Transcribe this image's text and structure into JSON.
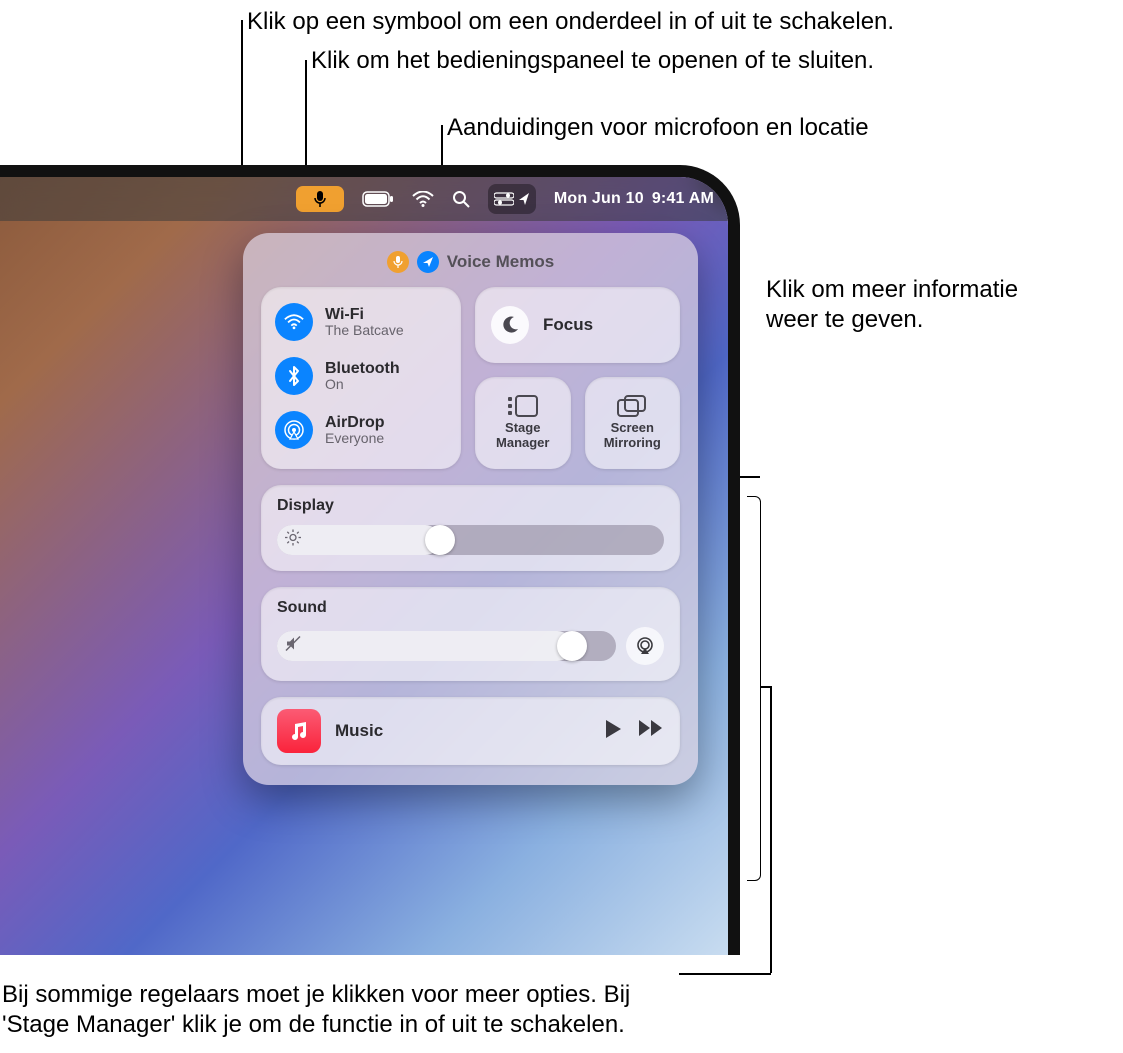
{
  "callouts": {
    "toggle": "Klik op een symbool om een onderdeel in of uit te schakelen.",
    "open_cc": "Klik om het bedieningspaneel te openen of te sluiten.",
    "indicators": "Aanduidingen voor microfoon en locatie",
    "more_info_1": "Klik om meer informatie",
    "more_info_2": "weer te geven.",
    "bottom_1": "Bij sommige regelaars moet je klikken voor meer opties. Bij",
    "bottom_2": "'Stage Manager' klik je om de functie in of uit te schakelen."
  },
  "menubar": {
    "date": "Mon Jun 10",
    "time": "9:41 AM"
  },
  "status_app": "Voice Memos",
  "connectivity": {
    "wifi": {
      "title": "Wi-Fi",
      "subtitle": "The Batcave"
    },
    "bluetooth": {
      "title": "Bluetooth",
      "subtitle": "On"
    },
    "airdrop": {
      "title": "AirDrop",
      "subtitle": "Everyone"
    }
  },
  "focus_label": "Focus",
  "stage": {
    "l1": "Stage",
    "l2": "Manager"
  },
  "mirror": {
    "l1": "Screen",
    "l2": "Mirroring"
  },
  "display_label": "Display",
  "sound_label": "Sound",
  "media_label": "Music",
  "sliders": {
    "display_pct": 42,
    "sound_pct": 87
  }
}
